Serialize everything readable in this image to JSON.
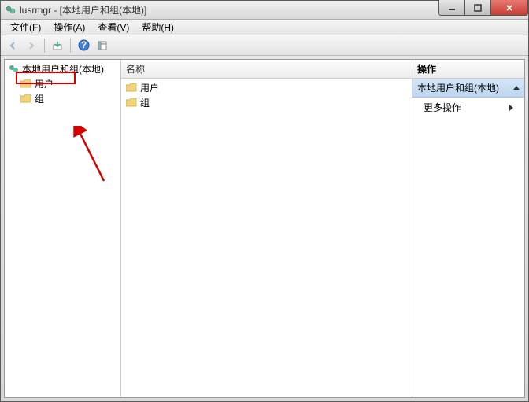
{
  "title": "lusrmgr - [本地用户和组(本地)]",
  "menu": {
    "file": "文件(F)",
    "action": "操作(A)",
    "view": "查看(V)",
    "help": "帮助(H)"
  },
  "tree": {
    "root": "本地用户和组(本地)",
    "users": "用户",
    "groups": "组"
  },
  "center": {
    "header": "名称",
    "users": "用户",
    "groups": "组"
  },
  "actions": {
    "header": "操作",
    "subject": "本地用户和组(本地)",
    "more": "更多操作"
  }
}
